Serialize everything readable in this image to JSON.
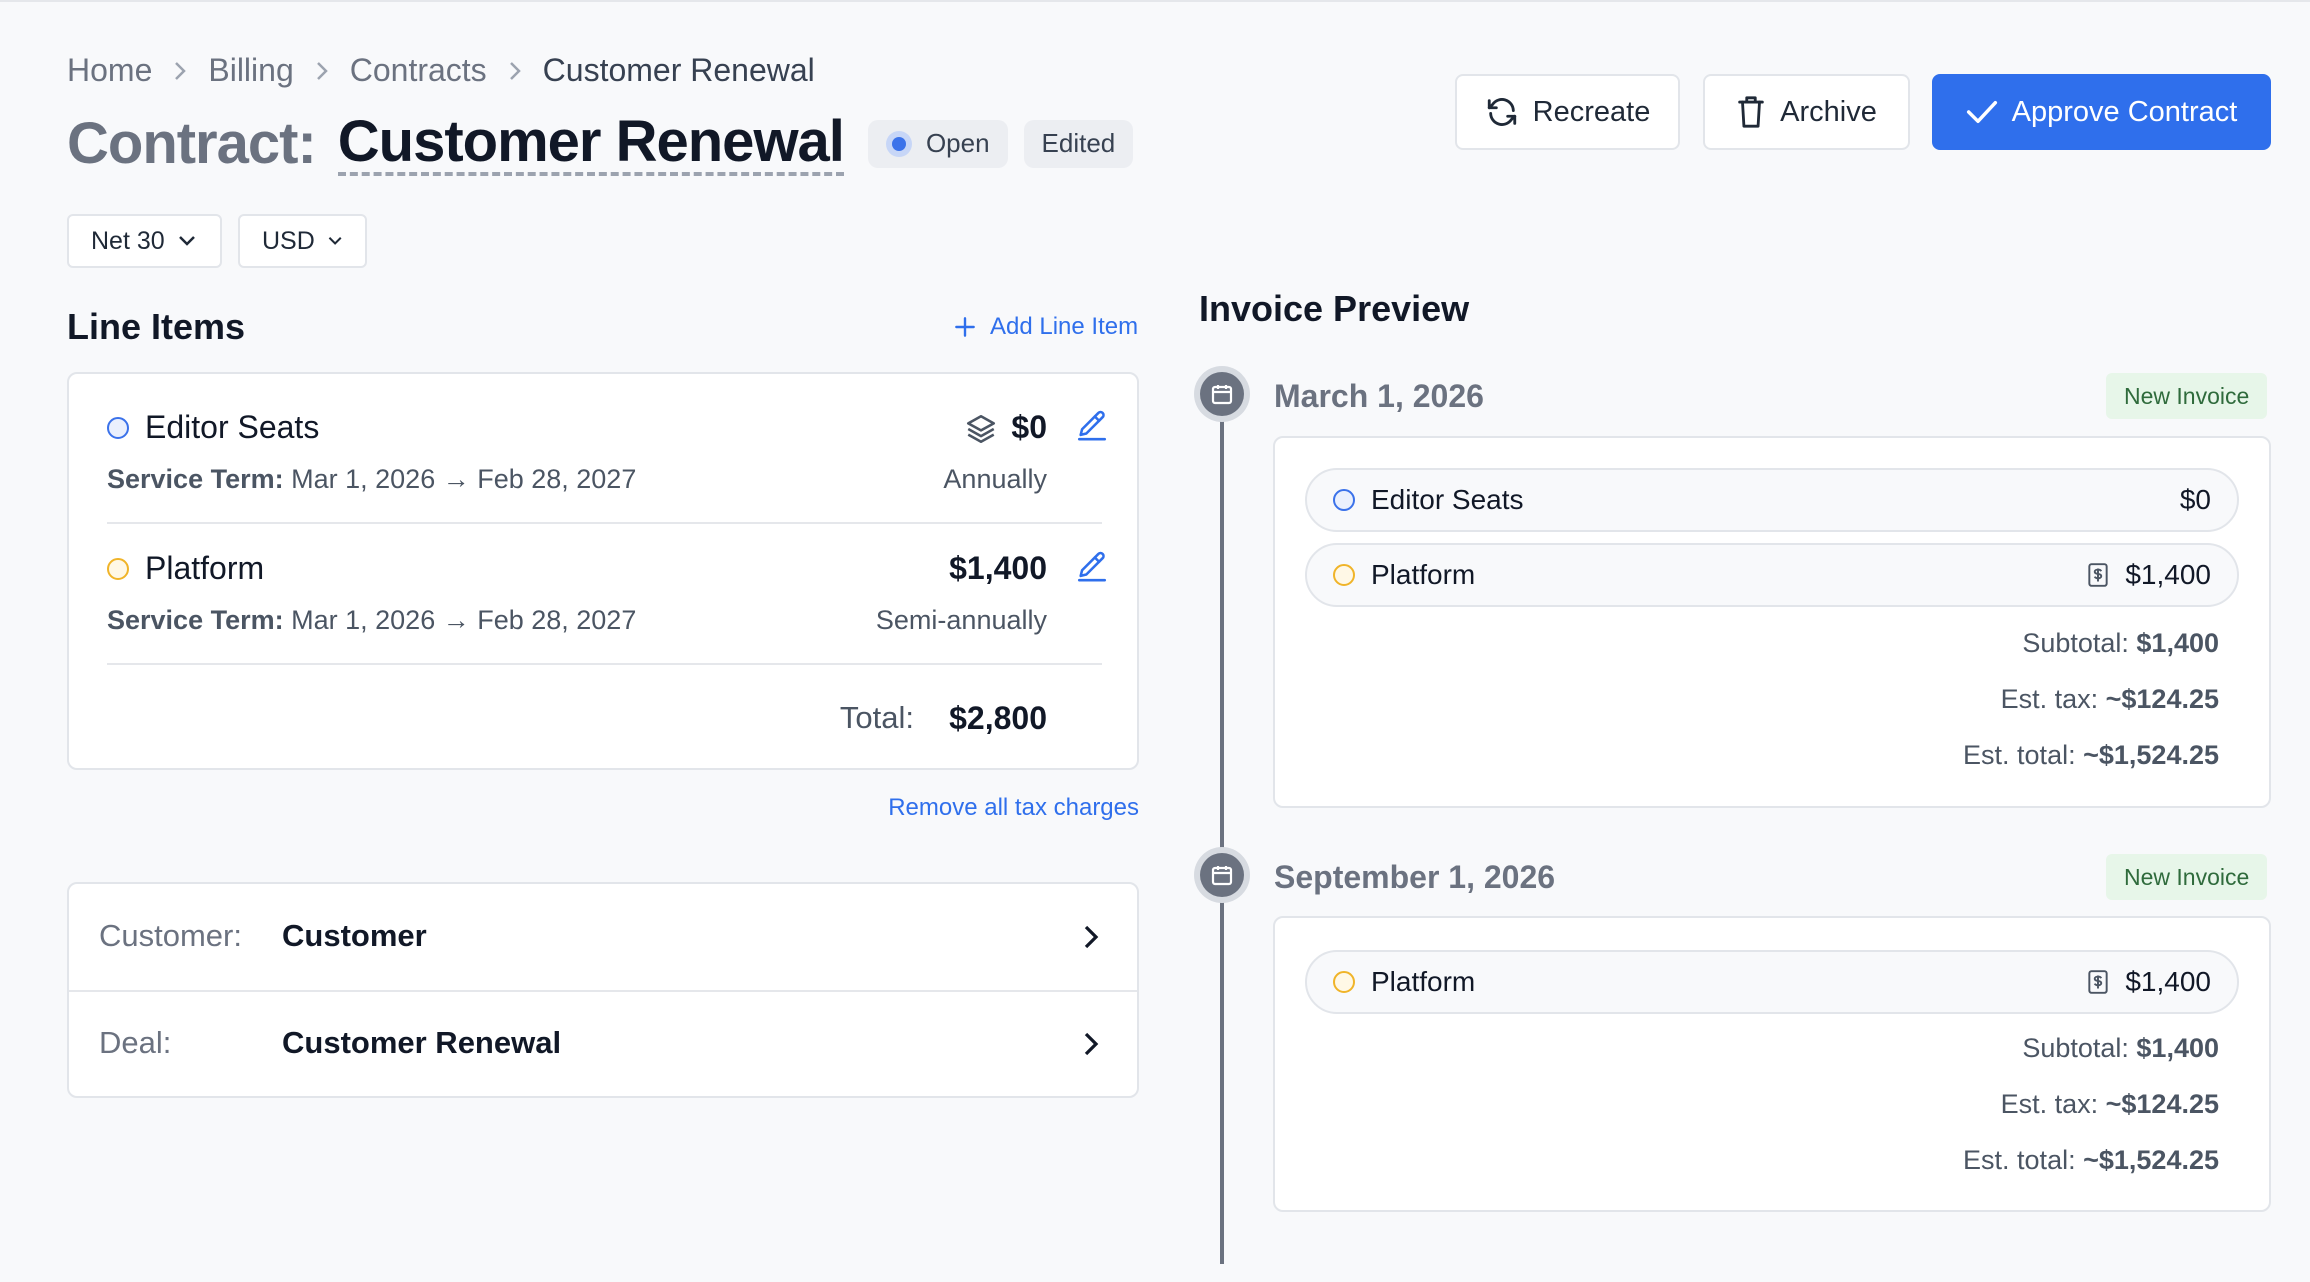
{
  "breadcrumb": {
    "home": "Home",
    "billing": "Billing",
    "contracts": "Contracts",
    "current": "Customer Renewal"
  },
  "title": {
    "prefix": "Contract:",
    "name": "Customer Renewal"
  },
  "badges": {
    "status": "Open",
    "edited": "Edited"
  },
  "actions": {
    "recreate": "Recreate",
    "archive": "Archive",
    "approve": "Approve Contract"
  },
  "filters": {
    "terms": "Net 30",
    "currency": "USD"
  },
  "line_items": {
    "title": "Line Items",
    "add_label": "Add Line Item",
    "term_label": "Service Term:",
    "items": [
      {
        "name": "Editor Seats",
        "term": "Mar 1, 2026 → Feb 28, 2027",
        "amount": "$0",
        "period": "Annually"
      },
      {
        "name": "Platform",
        "term": "Mar 1, 2026 → Feb 28, 2027",
        "amount": "$1,400",
        "period": "Semi-annually"
      }
    ],
    "total_label": "Total:",
    "total_value": "$2,800",
    "remove_tax_label": "Remove all tax charges"
  },
  "relations": {
    "customer_label": "Customer:",
    "customer_value": "Customer",
    "deal_label": "Deal:",
    "deal_value": "Customer Renewal"
  },
  "invoice_preview": {
    "title": "Invoice Preview",
    "invoices": [
      {
        "date": "March 1, 2026",
        "badge": "New Invoice",
        "lines": [
          {
            "name": "Editor Seats",
            "amount": "$0"
          },
          {
            "name": "Platform",
            "amount": "$1,400"
          }
        ],
        "subtotal_label": "Subtotal:",
        "subtotal": "$1,400",
        "tax_label": "Est. tax:",
        "tax": "~$124.25",
        "total_label": "Est. total:",
        "total": "~$1,524.25"
      },
      {
        "date": "September 1, 2026",
        "badge": "New Invoice",
        "lines": [
          {
            "name": "Platform",
            "amount": "$1,400"
          }
        ],
        "subtotal_label": "Subtotal:",
        "subtotal": "$1,400",
        "tax_label": "Est. tax:",
        "tax": "~$124.25",
        "total_label": "Est. total:",
        "total": "~$1,524.25"
      }
    ]
  },
  "colors": {
    "accent": "#2f6fec",
    "ring_blue": "#3b72ea",
    "ring_yellow": "#f0b429",
    "new_badge_bg": "#e7f6e9"
  }
}
